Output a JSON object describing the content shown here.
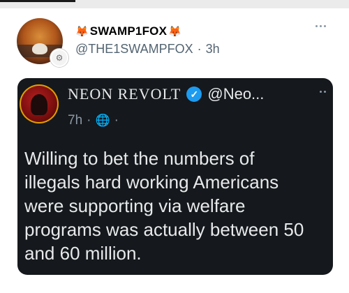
{
  "author": {
    "display_name": "SWAMP1FOX",
    "handle": "@THE1SWAMPFOX",
    "separator": "·",
    "time": "3h",
    "name_emoji": "🦊"
  },
  "quoted_tweet": {
    "display_name": "NEON REVOLT",
    "handle": "@Neo...",
    "time": "7h",
    "separator": "·",
    "text": "Willing to bet the numbers of\nillegals hard working Americans\nwere supporting via welfare\nprograms was actually between 50\nand 60 million."
  },
  "icons": {
    "more": "more-horizontal-icon",
    "verified": "verified-badge-icon",
    "globe": "globe-icon"
  },
  "colors": {
    "card_bg": "#15181c",
    "verified": "#1d9bf0",
    "muted": "#536471"
  }
}
